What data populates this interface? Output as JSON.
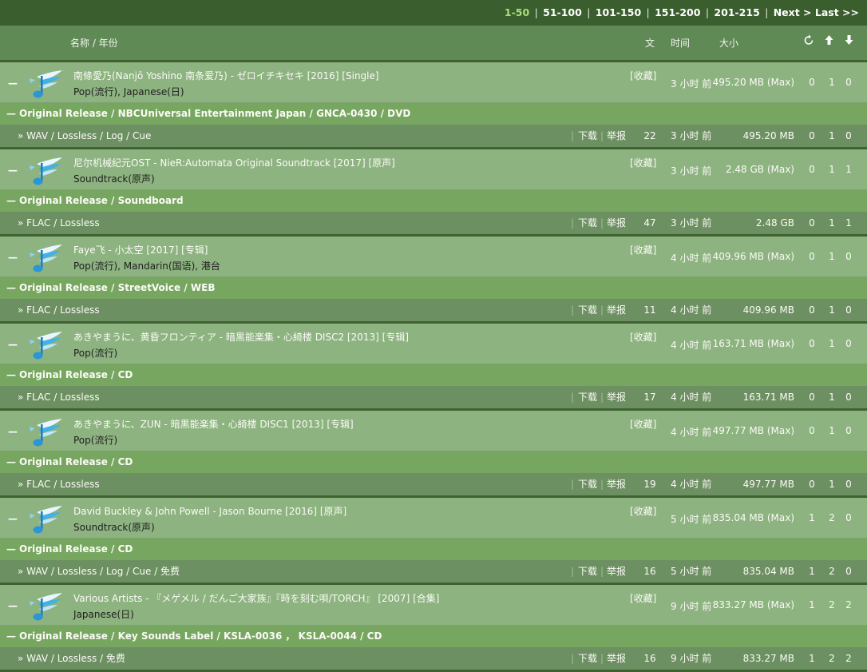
{
  "pager": {
    "current": "1-50",
    "pages": [
      "51-100",
      "101-150",
      "151-200",
      "201-215"
    ],
    "next": "Next >",
    "last": "Last >>",
    "separator": "|"
  },
  "header": {
    "name_year": "名称 / 年份",
    "files": "文",
    "time": "时间",
    "size": "大小",
    "icons": [
      "refresh-icon",
      "up-arrow-icon",
      "down-arrow-icon"
    ]
  },
  "labels": {
    "collapse": "—",
    "favorite": "[收藏]",
    "download": "下载",
    "report": "举报",
    "bar": "|",
    "file_prefix": "»"
  },
  "colors": {
    "page_bg": "#3e6330",
    "header_bg": "#5f8a55",
    "group_bg": "#8db380",
    "edition_bg": "#76a65f",
    "file_bg": "#6d9062",
    "current_page": "#a8e07a"
  },
  "torrents": [
    {
      "title": "南條愛乃(Nanjō Yoshino 南条爱乃) - ゼロイチキセキ [2016] [Single]",
      "tags": "Pop(流行), Japanese(日)",
      "time": "3 小时 前",
      "size_max": "495.20 MB (Max)",
      "stats": [
        "0",
        "1",
        "0"
      ],
      "edition": "Original Release / NBCUniversal Entertainment Japan / GNCA-0430 / DVD",
      "format": "WAV / Lossless / Log / Cue",
      "files": "22",
      "size": "495.20 MB"
    },
    {
      "title": "尼尔机械纪元OST - NieR:Automata Original Soundtrack [2017] [原声]",
      "tags": "Soundtrack(原声)",
      "time": "3 小时 前",
      "size_max": "2.48 GB (Max)",
      "stats": [
        "0",
        "1",
        "1"
      ],
      "edition": "Original Release / Soundboard",
      "format": "FLAC / Lossless",
      "files": "47",
      "size": "2.48 GB"
    },
    {
      "title": "Faye飞 - 小太空 [2017] [专辑]",
      "tags": "Pop(流行), Mandarin(国语), 港台",
      "time": "4 小时 前",
      "size_max": "409.96 MB (Max)",
      "stats": [
        "0",
        "1",
        "0"
      ],
      "edition": "Original Release / StreetVoice / WEB",
      "format": "FLAC / Lossless",
      "files": "11",
      "size": "409.96 MB"
    },
    {
      "title": "あきやまうに、黄昏フロンティア - 暗黒能楽集・心綺楼 DISC2 [2013] [专辑]",
      "tags": "Pop(流行)",
      "time": "4 小时 前",
      "size_max": "163.71 MB (Max)",
      "stats": [
        "0",
        "1",
        "0"
      ],
      "edition": "Original Release / CD",
      "format": "FLAC / Lossless",
      "files": "17",
      "size": "163.71 MB"
    },
    {
      "title": "あきやまうに、ZUN - 暗黒能楽集・心綺楼 DISC1 [2013] [专辑]",
      "tags": "Pop(流行)",
      "time": "4 小时 前",
      "size_max": "497.77 MB (Max)",
      "stats": [
        "0",
        "1",
        "0"
      ],
      "edition": "Original Release / CD",
      "format": "FLAC / Lossless",
      "files": "19",
      "size": "497.77 MB"
    },
    {
      "title": "David Buckley & John Powell - Jason Bourne [2016] [原声]",
      "tags": "Soundtrack(原声)",
      "time": "5 小时 前",
      "size_max": "835.04 MB (Max)",
      "stats": [
        "1",
        "2",
        "0"
      ],
      "edition": "Original Release / CD",
      "format": "WAV / Lossless / Log / Cue / 免费",
      "files": "16",
      "size": "835.04 MB"
    },
    {
      "title": "Various Artists - 『メゲメル / だんご大家族』『時を刻む唄/TORCH』 [2007] [合集]",
      "tags": "Japanese(日)",
      "time": "9 小时 前",
      "size_max": "833.27 MB (Max)",
      "stats": [
        "1",
        "2",
        "2"
      ],
      "edition": "Original Release / Key Sounds Label / KSLA-0036 ， KSLA-0044 / CD",
      "format": "WAV / Lossless / 免费",
      "files": "16",
      "size": "833.27 MB"
    }
  ]
}
